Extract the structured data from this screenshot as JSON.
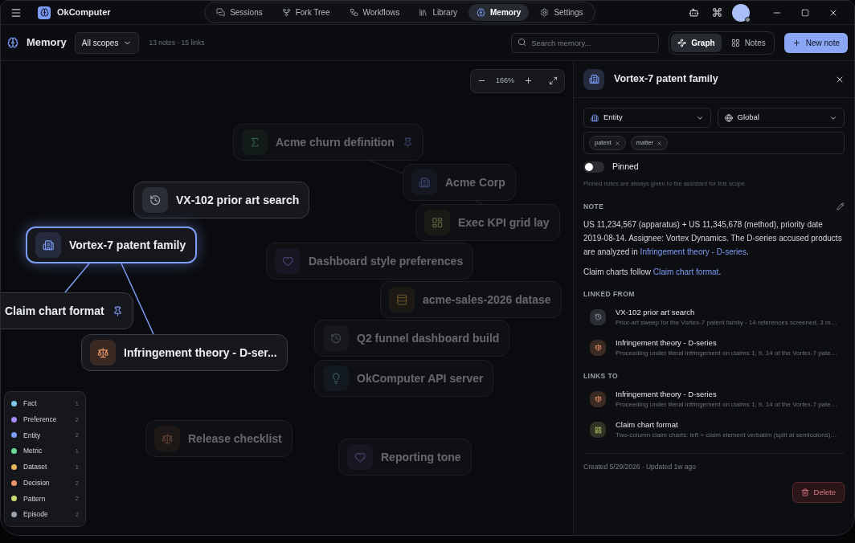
{
  "app": {
    "title": "OkComputer"
  },
  "nav": [
    {
      "label": "Sessions",
      "selected": false
    },
    {
      "label": "Fork Tree",
      "selected": false
    },
    {
      "label": "Workflows",
      "selected": false
    },
    {
      "label": "Library",
      "selected": false
    },
    {
      "label": "Memory",
      "selected": true
    },
    {
      "label": "Settings",
      "selected": false
    }
  ],
  "header": {
    "title": "Memory",
    "scope": "All scopes",
    "stats": "13 notes · 15 links",
    "search": {
      "placeholder": "Search memory..."
    },
    "views": [
      {
        "label": "Graph",
        "selected": true
      },
      {
        "label": "Notes",
        "selected": false
      }
    ],
    "new_button": "New note"
  },
  "zoom": {
    "value": "166%"
  },
  "nodes": [
    {
      "label": "Acme churn definition",
      "kind": "metric",
      "selected": false,
      "faded": true,
      "pinned": true
    },
    {
      "label": "Acme Corp",
      "kind": "entity",
      "selected": false,
      "faded": true,
      "pinned": false
    },
    {
      "label": "VX-102 prior art search",
      "kind": "episode",
      "selected": false,
      "faded": false,
      "pinned": false
    },
    {
      "label": "Exec KPI grid lay",
      "kind": "pattern",
      "selected": false,
      "faded": true,
      "pinned": false
    },
    {
      "label": "Dashboard style preferences",
      "kind": "preference",
      "selected": false,
      "faded": true,
      "pinned": false
    },
    {
      "label": "acme-sales-2026 datase",
      "kind": "dataset",
      "selected": false,
      "faded": true,
      "pinned": false
    },
    {
      "label": "Vortex-7 patent family",
      "kind": "entity",
      "selected": true,
      "faded": false,
      "pinned": false
    },
    {
      "label": "Q2 funnel dashboard build",
      "kind": "episode",
      "selected": false,
      "faded": true,
      "pinned": false
    },
    {
      "label": "OkComputer API server",
      "kind": "fact",
      "selected": false,
      "faded": true,
      "pinned": false
    },
    {
      "label": "Infringement theory - D-ser...",
      "kind": "decision",
      "selected": false,
      "faded": false,
      "pinned": false
    },
    {
      "label": "Claim chart format",
      "selected": false,
      "faded": false,
      "pinned": true
    },
    {
      "label": "Release checklist",
      "kind": "decision",
      "selected": false,
      "faded": true,
      "pinned": false
    },
    {
      "label": "Reporting tone",
      "kind": "preference",
      "selected": false,
      "faded": true,
      "pinned": false
    }
  ],
  "legend": [
    {
      "label": "Fact",
      "count": "1",
      "color": "#7dc8e8"
    },
    {
      "label": "Preference",
      "count": "2",
      "color": "#a78bfa"
    },
    {
      "label": "Entity",
      "count": "2",
      "color": "#7c9cf5"
    },
    {
      "label": "Metric",
      "count": "1",
      "color": "#6fd69a"
    },
    {
      "label": "Dataset",
      "count": "1",
      "color": "#e8b45c"
    },
    {
      "label": "Decision",
      "count": "2",
      "color": "#e8936a"
    },
    {
      "label": "Pattern",
      "count": "2",
      "color": "#c9dc72"
    },
    {
      "label": "Episode",
      "count": "2",
      "color": "#9ca3af"
    }
  ],
  "detail": {
    "title": "Vortex-7 patent family",
    "kind": "entity",
    "type_select": "Entity",
    "scope_select": "Global",
    "tags": [
      "patent",
      "matter"
    ],
    "pinned": {
      "label": "Pinned",
      "on": false,
      "hint": "Pinned notes are always given to the assistant for this scope."
    },
    "note_label": "NOTE",
    "note": [
      [
        {
          "text": "US 11,234,567 (apparatus) + US 11,345,678 (method), priority date 2019-08-14. Assignee: Vortex Dynamics. The D-series accused products are analyzed in "
        },
        {
          "link": "Infringement theory - D-series"
        },
        {
          "text": "."
        }
      ],
      [
        {
          "text": "Claim charts follow "
        },
        {
          "link": "Claim chart format"
        },
        {
          "text": "."
        }
      ]
    ],
    "linked_from_label": "LINKED FROM",
    "linked_from": [
      {
        "kind": "episode",
        "title": "VX-102 prior art search",
        "snippet": "Prior-art sweep for the Vortex-7 patent family - 14 references screened, 3 m…"
      },
      {
        "kind": "decision",
        "title": "Infringement theory - D-series",
        "snippet": "Proceeding under literal infringement on claims 1, 9, 14 of the Vortex-7 pate…"
      }
    ],
    "links_to_label": "LINKS TO",
    "links_to": [
      {
        "kind": "decision",
        "title": "Infringement theory - D-series",
        "snippet": "Proceeding under literal infringement on claims 1, 9, 14 of the Vortex-7 pate…"
      },
      {
        "kind": "pattern",
        "title": "Claim chart format",
        "snippet": "Two-column claim charts: left = claim element verbatim (split at semicolons)…"
      }
    ],
    "meta": "Created 5/29/2026 · Updated 1w ago",
    "delete_button": "Delete"
  }
}
